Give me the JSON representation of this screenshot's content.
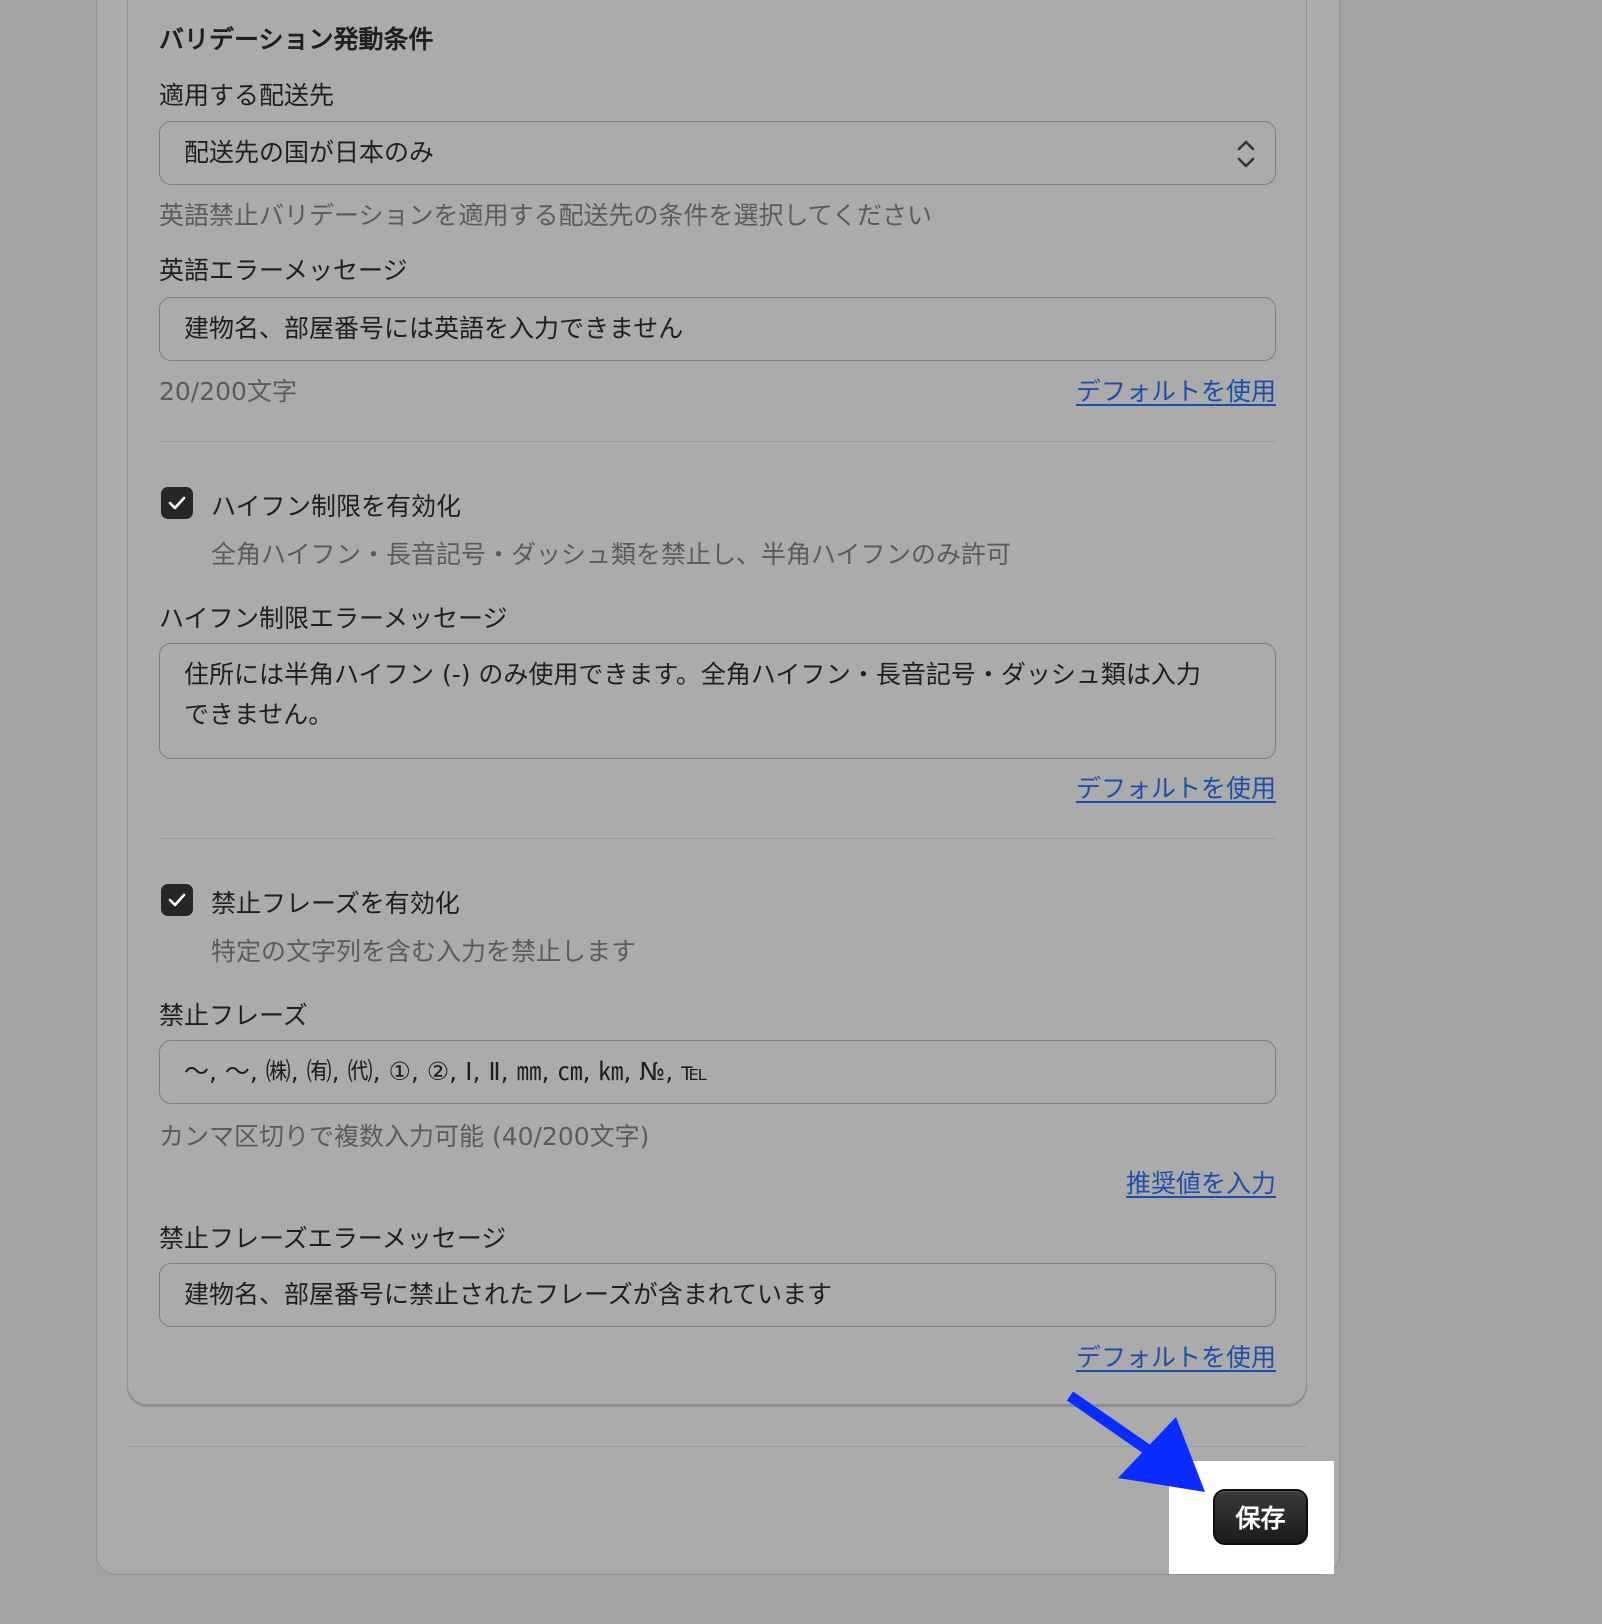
{
  "validation_trigger": {
    "section_title": "バリデーション発動条件",
    "destination_label": "適用する配送先",
    "destination_value": "配送先の国が日本のみ",
    "destination_help": "英語禁止バリデーションを適用する配送先の条件を選択してください",
    "english_error_label": "英語エラーメッセージ",
    "english_error_value": "建物名、部屋番号には英語を入力できません",
    "english_error_count": "20/200文字",
    "use_default_link": "デフォルトを使用"
  },
  "hyphen": {
    "checkbox_label": "ハイフン制限を有効化",
    "checkbox_checked": true,
    "checkbox_help": "全角ハイフン・長音記号・ダッシュ類を禁止し、半角ハイフンのみ許可",
    "error_label": "ハイフン制限エラーメッセージ",
    "error_value_line1": "住所には半角ハイフン (-) のみ使用できます。全角ハイフン・長音記号・ダッシュ類は入力",
    "error_value_line2": "できません。",
    "use_default_link": "デフォルトを使用"
  },
  "phrases": {
    "checkbox_label": "禁止フレーズを有効化",
    "checkbox_checked": true,
    "checkbox_help": "特定の文字列を含む入力を禁止します",
    "phrases_label": "禁止フレーズ",
    "phrases_value": "〜, ～, ㈱, ㈲, ㈹, ①, ②, Ⅰ, Ⅱ, ㎜, ㎝, ㎞, №, ℡",
    "phrases_help": "カンマ区切りで複数入力可能 (40/200文字)",
    "recommended_link": "推奨値を入力",
    "error_label": "禁止フレーズエラーメッセージ",
    "error_value": "建物名、部屋番号に禁止されたフレーズが含まれています",
    "use_default_link": "デフォルトを使用"
  },
  "footer": {
    "save_label": "保存"
  },
  "colors": {
    "background": "#a3a3a3",
    "link": "#1e4fa8",
    "button": "#1b1b1b",
    "annotation_arrow": "#0a2cff"
  },
  "icons": [
    "select-arrows-icon",
    "checkmark-icon",
    "annotation-arrow-icon"
  ]
}
